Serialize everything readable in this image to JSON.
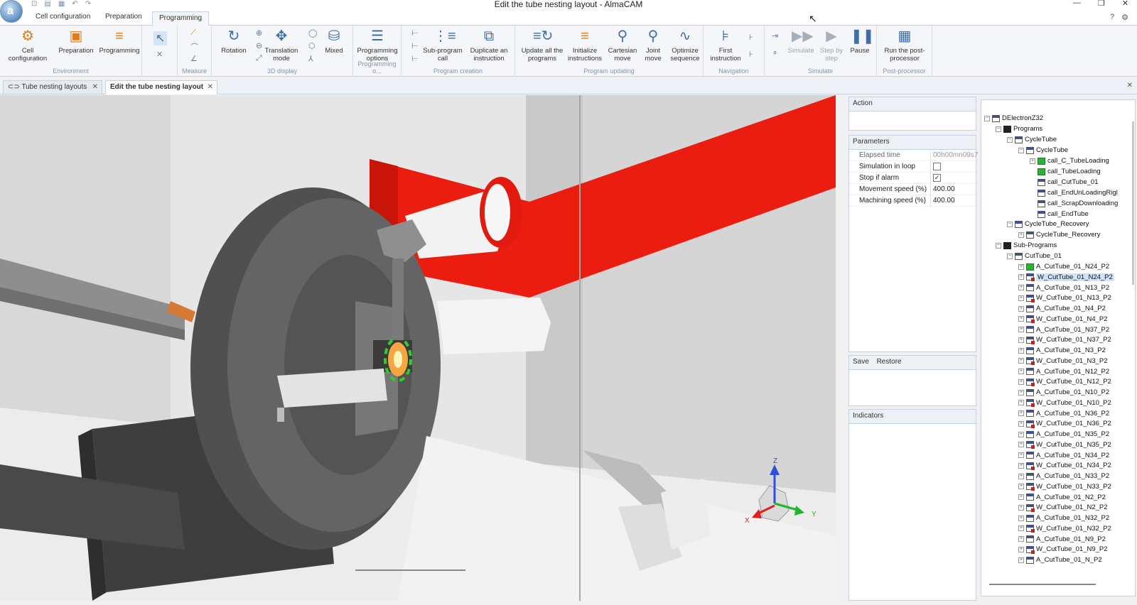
{
  "window": {
    "title": "Edit the tube nesting layout - AlmaCAM"
  },
  "menu_tabs": [
    "Cell configuration",
    "Preparation",
    "Programming"
  ],
  "ribbon": {
    "environment": {
      "title": "Environment",
      "buttons": [
        "Cell configuration",
        "Preparation",
        "Programming"
      ]
    },
    "measure": {
      "title": "Measure"
    },
    "display3d": {
      "title": "3D display",
      "buttons": [
        "Rotation",
        "Translation mode",
        "Mixed"
      ]
    },
    "programming_options": {
      "title": "Programming o...",
      "buttons": [
        "Programming options"
      ]
    },
    "program_creation": {
      "title": "Program creation",
      "buttons": [
        "Sub-program call",
        "Duplicate an instruction"
      ]
    },
    "program_updating": {
      "title": "Program updating",
      "buttons": [
        "Update all the programs",
        "Initialize instructions",
        "Cartesian move",
        "Joint move",
        "Optimize sequence"
      ]
    },
    "navigation": {
      "title": "Navigation",
      "buttons": [
        "First instruction"
      ]
    },
    "simulate": {
      "title": "Simulate",
      "buttons": [
        "Simulate",
        "Step by step",
        "Pause"
      ]
    },
    "post_processor": {
      "title": "Post-processor",
      "buttons": [
        "Run the post-processor"
      ]
    }
  },
  "doc_tabs": [
    "Tube nesting layouts",
    "Edit the tube nesting layout"
  ],
  "action_panel": {
    "title": "Action"
  },
  "parameters": {
    "title": "Parameters",
    "rows": [
      {
        "label": "Elapsed time",
        "value": "00h00mn09s7"
      },
      {
        "label": "Simulation in loop",
        "checked": false
      },
      {
        "label": "Stop if alarm",
        "checked": true
      },
      {
        "label": "Movement speed (%)",
        "value": "400.00"
      },
      {
        "label": "Machining speed (%)",
        "value": "400.00"
      }
    ]
  },
  "save_restore": {
    "save": "Save",
    "restore": "Restore"
  },
  "indicators": {
    "title": "Indicators"
  },
  "axes": {
    "x": "X",
    "y": "Y",
    "z": "Z"
  },
  "tree": {
    "root": "DElectronZ32",
    "programs": "Programs",
    "cycle_tube_group": "CycleTube",
    "cycle_tube": "CycleTube",
    "calls": [
      "call_C_TubeLoading",
      "call_TubeLoading",
      "call_CutTube_01",
      "call_EndUnLoadingRigl",
      "call_ScrapDownloading",
      "call_EndTube"
    ],
    "recovery_group": "CycleTube_Recovery",
    "recovery": "CycleTube_Recovery",
    "sub_programs": "Sub-Programs",
    "cut_tube": "CutTube_01",
    "items": [
      "A_CutTube_01_N24_P2",
      "W_CutTube_01_N24_P2",
      "A_CutTube_01_N13_P2",
      "W_CutTube_01_N13_P2",
      "A_CutTube_01_N4_P2",
      "W_CutTube_01_N4_P2",
      "A_CutTube_01_N37_P2",
      "W_CutTube_01_N37_P2",
      "A_CutTube_01_N3_P2",
      "W_CutTube_01_N3_P2",
      "A_CutTube_01_N12_P2",
      "W_CutTube_01_N12_P2",
      "A_CutTube_01_N10_P2",
      "W_CutTube_01_N10_P2",
      "A_CutTube_01_N36_P2",
      "W_CutTube_01_N36_P2",
      "A_CutTube_01_N35_P2",
      "W_CutTube_01_N35_P2",
      "A_CutTube_01_N34_P2",
      "W_CutTube_01_N34_P2",
      "A_CutTube_01_N33_P2",
      "W_CutTube_01_N33_P2",
      "A_CutTube_01_N2_P2",
      "W_CutTube_01_N2_P2",
      "A_CutTube_01_N32_P2",
      "W_CutTube_01_N32_P2",
      "A_CutTube_01_N9_P2",
      "W_CutTube_01_N9_P2",
      "A_CutTube_01_N_P2"
    ]
  }
}
